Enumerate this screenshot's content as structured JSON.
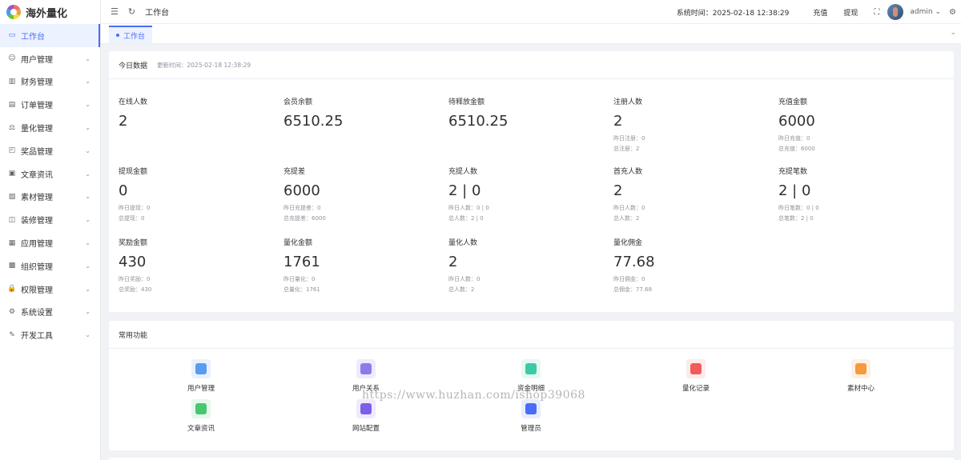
{
  "app": {
    "name": "海外量化"
  },
  "sidebar": {
    "items": [
      {
        "label": "工作台",
        "icon": "monitor-icon",
        "active": true
      },
      {
        "label": "用户管理",
        "icon": "user-icon"
      },
      {
        "label": "财务管理",
        "icon": "chart-icon"
      },
      {
        "label": "订单管理",
        "icon": "order-icon"
      },
      {
        "label": "量化管理",
        "icon": "quant-icon"
      },
      {
        "label": "奖品管理",
        "icon": "bag-icon"
      },
      {
        "label": "文章资讯",
        "icon": "article-icon"
      },
      {
        "label": "素材管理",
        "icon": "image-icon"
      },
      {
        "label": "装修管理",
        "icon": "decor-icon"
      },
      {
        "label": "应用管理",
        "icon": "app-icon"
      },
      {
        "label": "组织管理",
        "icon": "org-icon"
      },
      {
        "label": "权限管理",
        "icon": "lock-icon"
      },
      {
        "label": "系统设置",
        "icon": "gear-icon"
      },
      {
        "label": "开发工具",
        "icon": "pen-icon"
      }
    ]
  },
  "topbar": {
    "breadcrumb": "工作台",
    "system_time": "系统时间：2025-02-18 12:38:29",
    "recharge": "充值",
    "withdraw": "提现",
    "user": "admin"
  },
  "tags": {
    "active": "工作台"
  },
  "today": {
    "title": "今日数据",
    "updated": "更新时间：2025-02-18 12:38:29",
    "stats": [
      {
        "label": "在线人数",
        "value": "2",
        "subs": []
      },
      {
        "label": "会员余额",
        "value": "6510.25",
        "subs": []
      },
      {
        "label": "待释放金额",
        "value": "6510.25",
        "subs": []
      },
      {
        "label": "注册人数",
        "value": "2",
        "subs": [
          "昨日注册：0",
          "总注册：2"
        ]
      },
      {
        "label": "充值金额",
        "value": "6000",
        "subs": [
          "昨日充值：0",
          "总充值：6000"
        ]
      },
      {
        "label": "提现金额",
        "value": "0",
        "subs": [
          "昨日提现：0",
          "总提现：0"
        ]
      },
      {
        "label": "充提差",
        "value": "6000",
        "subs": [
          "昨日充提差：0",
          "总充提差：6000"
        ]
      },
      {
        "label": "充提人数",
        "value": "2 | 0",
        "subs": [
          "昨日人数：0 | 0",
          "总人数：2 | 0"
        ]
      },
      {
        "label": "首充人数",
        "value": "2",
        "subs": [
          "昨日人数：0",
          "总人数：2"
        ]
      },
      {
        "label": "充提笔数",
        "value": "2 | 0",
        "subs": [
          "昨日笔数：0 | 0",
          "总笔数：2 | 0"
        ]
      },
      {
        "label": "奖励金额",
        "value": "430",
        "subs": [
          "昨日奖励：0",
          "总奖励：430"
        ]
      },
      {
        "label": "量化金额",
        "value": "1761",
        "subs": [
          "昨日量化：0",
          "总量化：1761"
        ]
      },
      {
        "label": "量化人数",
        "value": "2",
        "subs": [
          "昨日人数：0",
          "总人数：2"
        ]
      },
      {
        "label": "量化佣金",
        "value": "77.68",
        "subs": [
          "昨日佣金：0",
          "总佣金：77.68"
        ]
      }
    ]
  },
  "common": {
    "title": "常用功能",
    "items": [
      {
        "label": "用户管理",
        "icon": "user-manage-icon",
        "bg": "#e8f1fd",
        "fg": "#5b9bf0"
      },
      {
        "label": "用户关系",
        "icon": "user-relation-icon",
        "bg": "#efeafd",
        "fg": "#8c7be8"
      },
      {
        "label": "资金明细",
        "icon": "funds-detail-icon",
        "bg": "#e6f8f3",
        "fg": "#3dc9a5"
      },
      {
        "label": "量化记录",
        "icon": "quant-record-icon",
        "bg": "#fdeaea",
        "fg": "#f05b5b"
      },
      {
        "label": "素材中心",
        "icon": "material-center-icon",
        "bg": "#fef0e4",
        "fg": "#f59a3d"
      },
      {
        "label": "文章资讯",
        "icon": "article-news-icon",
        "bg": "#e6f7ec",
        "fg": "#48c772"
      },
      {
        "label": "网站配置",
        "icon": "site-config-icon",
        "bg": "#efeafd",
        "fg": "#7c5fe6"
      },
      {
        "label": "管理员",
        "icon": "admin-icon",
        "bg": "#e8edfd",
        "fg": "#4a6cf7"
      }
    ]
  },
  "watermark": "https://www.huzhan.com/ishop39068"
}
